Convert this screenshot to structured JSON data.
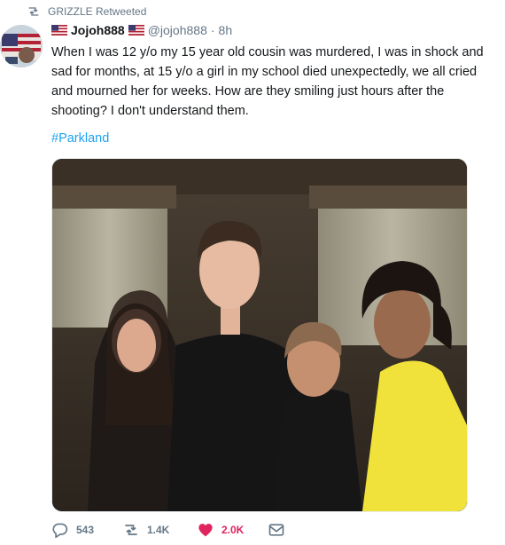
{
  "retweeter": {
    "label": "GRIZZLE Retweeted",
    "icon": "retweet-icon"
  },
  "tweet": {
    "display_name": "Jojoh888",
    "handle": "@jojoh888",
    "separator": "·",
    "time": "8h",
    "text": "When I was 12 y/o my 15 year old cousin was murdered, I was in shock and sad for months, at 15 y/o a girl in my school died unexpectedly, we all cried and mourned her for weeks. How are they smiling just hours after the shooting? I don't understand them.",
    "hashtag": "#Parkland"
  },
  "actions": {
    "replies": "543",
    "retweets": "1.4K",
    "likes": "2.0K"
  },
  "icons": [
    "retweet-icon",
    "us-flag-icon",
    "reply-icon",
    "heart-icon",
    "envelope-icon"
  ],
  "colors": {
    "link": "#1da1f2",
    "like": "#e0245e",
    "muted": "#657786",
    "text": "#14171a"
  }
}
